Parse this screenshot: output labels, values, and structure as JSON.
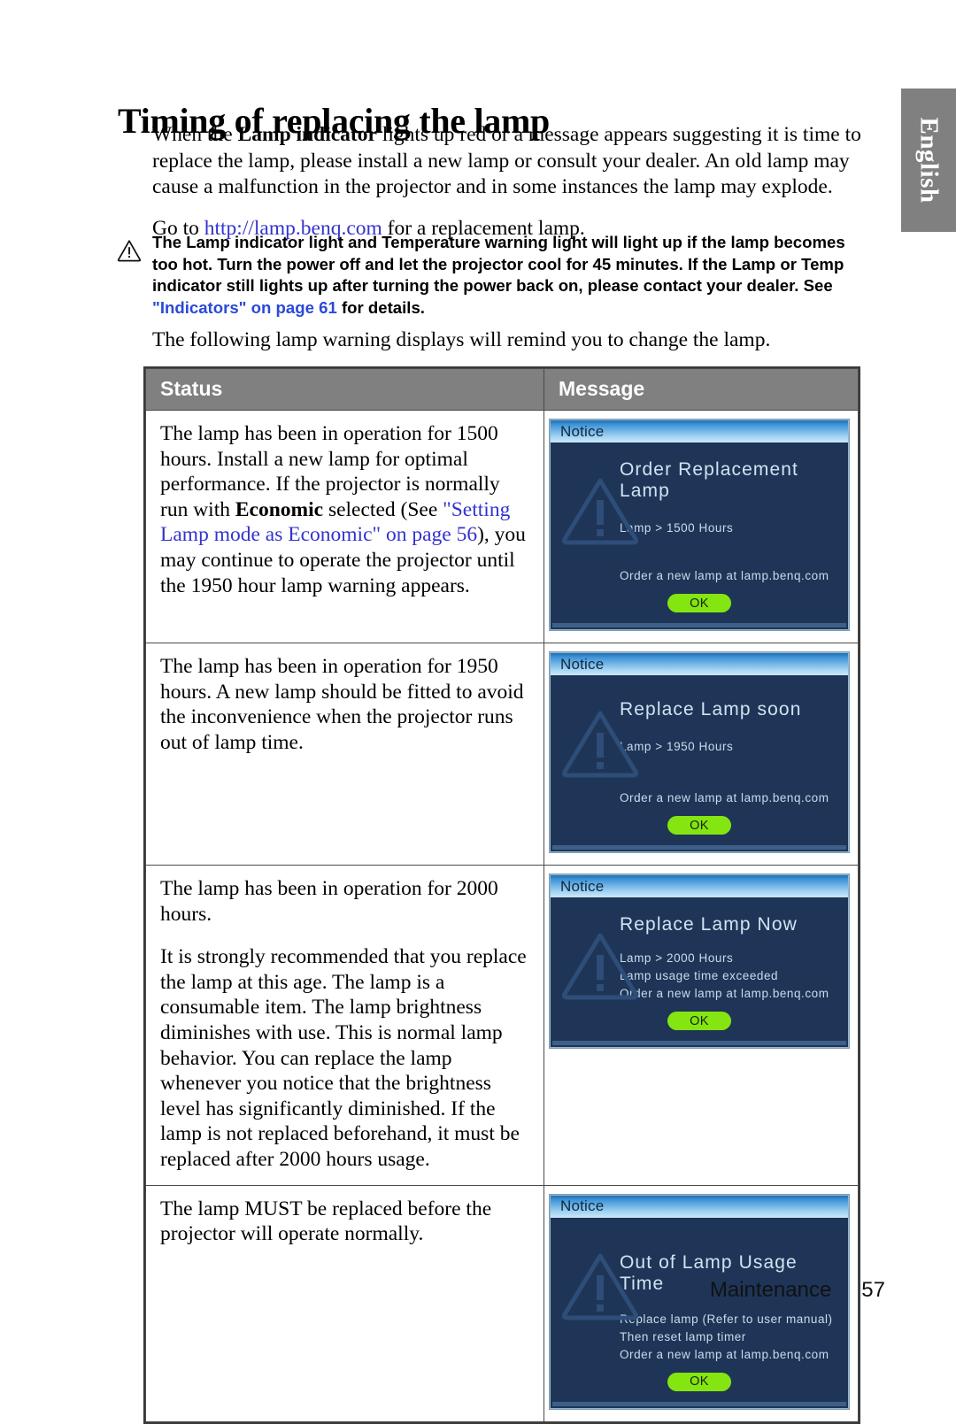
{
  "language_tab": {
    "label": "English"
  },
  "page": {
    "title": "Timing of replacing the lamp",
    "intro_paragraph_1_part1": "When the ",
    "intro_paragraph_1_bold": "Lamp indicator",
    "intro_paragraph_1_part2": " lights up red or a message appears suggesting it is time to replace the lamp, please install a new lamp or consult your dealer. An old lamp may cause a malfunction in the projector and in some instances the lamp may explode.",
    "intro_paragraph_2_part1": "Go to ",
    "intro_paragraph_2_link": "http://lamp.benq.com",
    "intro_paragraph_2_part2": " for a replacement lamp.",
    "lead_in": "The following lamp warning displays will remind you to change the lamp."
  },
  "caution": {
    "icon": "warning-triangle-icon",
    "text_part1": "The Lamp indicator light and Temperature warning light will light up if the lamp becomes too hot. Turn the power off and let the projector cool for 45 minutes. If the Lamp or Temp indicator still lights up after turning the power back on, please contact your dealer. See ",
    "link_1": "\"Indicators\" on page 61",
    "text_part2": " for details."
  },
  "table": {
    "headers": {
      "status": "Status",
      "message": "Message"
    },
    "rows": [
      {
        "status_paragraphs": [
          {
            "segments": [
              {
                "type": "text",
                "value": "The lamp has been in operation for 1500 hours. Install a new lamp for optimal performance. If the projector is normally run with "
              },
              {
                "type": "bold",
                "value": "Economic"
              },
              {
                "type": "text",
                "value": " selected (See "
              },
              {
                "type": "link",
                "value": "\"Setting Lamp mode as Economic\" on page 56"
              },
              {
                "type": "text",
                "value": "), you may continue to operate the projector until the 1950 hour lamp warning appears."
              }
            ]
          }
        ],
        "dialog": {
          "titlebar": "Notice",
          "heading": "Order Replacement Lamp",
          "lines_top": [
            "Lamp > 1500 Hours"
          ],
          "lines_bottom": [
            "Order a new lamp at lamp.benq.com"
          ],
          "ok_label": "OK",
          "watermark_icon": "warning-triangle-icon"
        }
      },
      {
        "status_paragraphs": [
          {
            "segments": [
              {
                "type": "text",
                "value": "The lamp has been in operation for 1950 hours. A new lamp should be fitted to avoid the inconvenience when the projector runs out of lamp time."
              }
            ]
          }
        ],
        "dialog": {
          "titlebar": "Notice",
          "heading": "Replace Lamp soon",
          "lines_top": [
            "Lamp > 1950 Hours"
          ],
          "lines_bottom": [
            "Order a new lamp at lamp.benq.com"
          ],
          "ok_label": "OK",
          "watermark_icon": "warning-triangle-icon"
        }
      },
      {
        "status_paragraphs": [
          {
            "segments": [
              {
                "type": "text",
                "value": "The lamp has been in operation for 2000 hours."
              }
            ]
          },
          {
            "segments": [
              {
                "type": "text",
                "value": "It is strongly recommended that you replace the lamp at this age. The lamp is a consumable item. The lamp brightness diminishes with use. This is normal lamp behavior. You can replace the lamp whenever you notice that the brightness level has significantly diminished. If the lamp is not replaced beforehand, it must be replaced after 2000 hours usage."
              }
            ]
          }
        ],
        "dialog": {
          "titlebar": "Notice",
          "heading": "Replace Lamp Now",
          "lines_top": [
            "Lamp > 2000 Hours",
            "Lamp usage time exceeded",
            "Order a new lamp at lamp.benq.com"
          ],
          "lines_bottom": [],
          "ok_label": "OK",
          "watermark_icon": "warning-triangle-icon"
        }
      },
      {
        "status_paragraphs": [
          {
            "segments": [
              {
                "type": "text",
                "value": "The lamp MUST be replaced before the projector will operate normally."
              }
            ]
          }
        ],
        "dialog": {
          "titlebar": "Notice",
          "heading": "Out of Lamp Usage Time",
          "lines_top": [
            "Replace lamp (Refer to user manual)",
            "Then reset lamp timer",
            "Order a new lamp at lamp.benq.com"
          ],
          "lines_bottom": [],
          "ok_label": "OK",
          "watermark_icon": "warning-triangle-icon"
        }
      }
    ]
  },
  "footer": {
    "section": "Maintenance",
    "page_number": "57"
  },
  "colors": {
    "link": "#3333cc",
    "note_link": "#2a49d8",
    "table_header_bg": "#808080",
    "osd_bg": "#1e3557",
    "osd_heading": "#cfe4f2",
    "osd_ok_green": "#85e510",
    "lang_tab_bg": "#808080"
  }
}
